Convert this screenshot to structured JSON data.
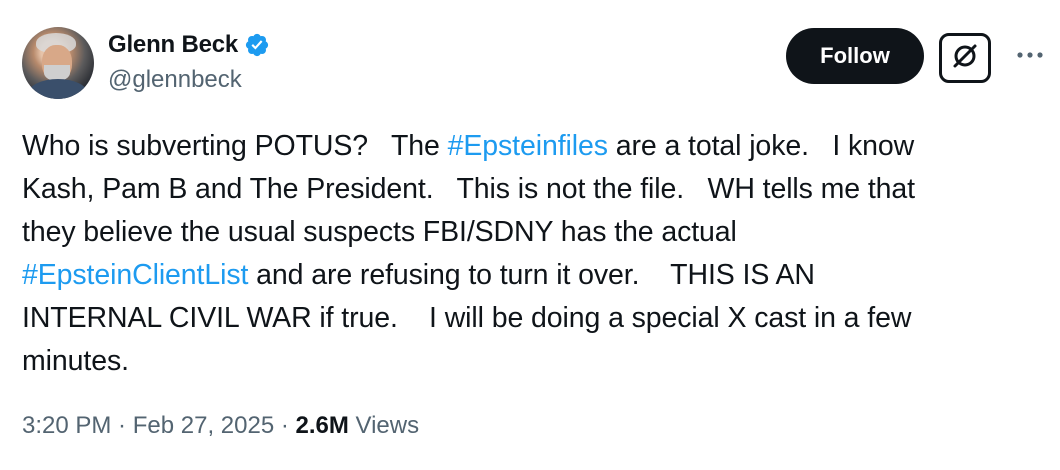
{
  "author": {
    "display_name": "Glenn Beck",
    "handle": "@glennbeck",
    "verified": true,
    "verified_color": "#1d9bf0"
  },
  "actions": {
    "follow_label": "Follow",
    "grok_icon": "grok-icon",
    "more_icon": "more-dots-icon"
  },
  "tweet": {
    "segments": {
      "s1": "Who is subverting POTUS?   The ",
      "h1": "#Epsteinfiles",
      "s2": " are a total joke.   I know",
      "s3": "Kash, Pam B and The President.   This is not the file.   WH tells me that",
      "s4": "they believe the usual suspects FBI/SDNY has the actual",
      "h2": "#EpsteinClientList",
      "s5": " and are refusing to turn it over.    THIS IS AN",
      "s6": "INTERNAL CIVIL WAR if true.    I will be doing a special X cast in a few",
      "s7": "minutes."
    },
    "hashtag_color": "#1d9bf0"
  },
  "meta": {
    "time": "3:20 PM",
    "sep1": " · ",
    "date": "Feb 27, 2025",
    "sep2": " · ",
    "views_count": "2.6M",
    "views_label": " Views"
  }
}
